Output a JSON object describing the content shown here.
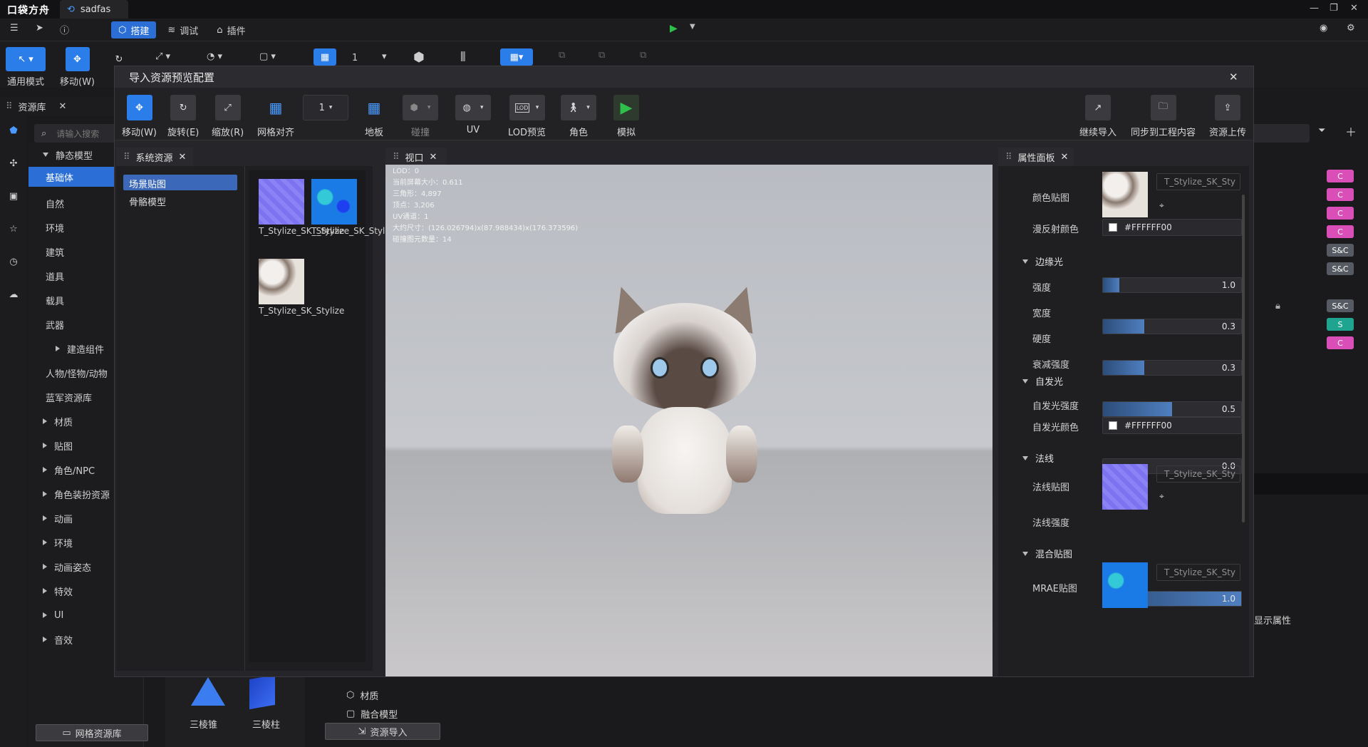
{
  "app": {
    "logo": "口袋方舟",
    "project_tab": "sadfas"
  },
  "menu": {
    "tabs": [
      {
        "label": "搭建"
      },
      {
        "label": "调试"
      },
      {
        "label": "插件"
      }
    ]
  },
  "toolbar": {
    "general_mode": "通用模式",
    "move": "移动(W)",
    "rotate_partial": "旋",
    "num_field": "1"
  },
  "library": {
    "title": "资源库",
    "search_placeholder": "请输入搜索",
    "items": [
      {
        "label": "静态模型"
      },
      {
        "label": "基础体"
      },
      {
        "label": "自然"
      },
      {
        "label": "环境"
      },
      {
        "label": "建筑"
      },
      {
        "label": "道具"
      },
      {
        "label": "载具"
      },
      {
        "label": "武器"
      },
      {
        "label": "建造组件"
      },
      {
        "label": "人物/怪物/动物"
      },
      {
        "label": "蓝军资源库"
      },
      {
        "label": "材质"
      },
      {
        "label": "贴图"
      },
      {
        "label": "角色/NPC"
      },
      {
        "label": "角色装扮资源"
      },
      {
        "label": "动画"
      },
      {
        "label": "环境"
      },
      {
        "label": "动画姿态"
      },
      {
        "label": "特效"
      },
      {
        "label": "UI"
      },
      {
        "label": "音效"
      }
    ],
    "bottom_button": "网格资源库"
  },
  "bottom": {
    "thumbs": [
      {
        "label": "三棱锥"
      },
      {
        "label": "三棱柱"
      }
    ],
    "list": [
      {
        "label": "材质"
      },
      {
        "label": "融合模型"
      }
    ],
    "import_button": "资源导入",
    "show_props": "显示属性"
  },
  "modal": {
    "title": "导入资源预览配置",
    "tools": [
      {
        "label": "移动(W)"
      },
      {
        "label": "旋转(E)"
      },
      {
        "label": "缩放(R)"
      },
      {
        "label": "网格对齐"
      },
      {
        "label": "地板"
      },
      {
        "label": "碰撞"
      },
      {
        "label": "UV"
      },
      {
        "label": "LOD预览"
      },
      {
        "label": "角色"
      },
      {
        "label": "模拟"
      }
    ],
    "grid_value": "1",
    "right_tools": [
      {
        "label": "继续导入"
      },
      {
        "label": "同步到工程内容"
      },
      {
        "label": "资源上传"
      }
    ],
    "system_panel": {
      "title": "系统资源",
      "categories": [
        {
          "label": "场景贴图"
        },
        {
          "label": "骨骼模型"
        }
      ],
      "textures": [
        {
          "label": "T_Stylize_SK_Stylize",
          "kind": "normal"
        },
        {
          "label": "T_Stylize_SK_Stylize",
          "kind": "mrao"
        },
        {
          "label": "T_Stylize_SK_Stylize",
          "kind": "color"
        }
      ]
    },
    "viewport": {
      "title": "视口",
      "stats": [
        "LOD：0",
        "当前屏幕大小：0.611",
        "三角形：4,897",
        "顶点：3,206",
        "UV通道：1",
        "大约尺寸：(126.026794)x(87.988434)x(176.373596)",
        "碰撞图元数量：14"
      ]
    },
    "properties": {
      "title": "属性面板",
      "color_map_label": "颜色贴图",
      "color_map_name": "T_Stylize_SK_Sty",
      "diffuse_label": "漫反射颜色",
      "diffuse_value": "#FFFFFF00",
      "rim_title": "边缘光",
      "rim": [
        {
          "label": "强度",
          "value": "1.0",
          "fill": 0.12
        },
        {
          "label": "宽度",
          "value": "0.3",
          "fill": 0.3
        },
        {
          "label": "硬度",
          "value": "0.3",
          "fill": 0.3
        },
        {
          "label": "衰减强度",
          "value": "0.5",
          "fill": 0.5
        }
      ],
      "emissive_title": "自发光",
      "emissive_strength_label": "自发光强度",
      "emissive_strength_value": "0.0",
      "emissive_color_label": "自发光颜色",
      "emissive_color_value": "#FFFFFF00",
      "normal_title": "法线",
      "normal_map_label": "法线贴图",
      "normal_map_name": "T_Stylize_SK_Sty",
      "normal_strength_label": "法线强度",
      "normal_strength_value": "1.0",
      "mix_title": "混合贴图",
      "mix_map_label": "MRAE贴图",
      "mix_map_name": "T_Stylize_SK_Sty"
    }
  },
  "right_badges": [
    {
      "label": "C",
      "color": "#d94fb7"
    },
    {
      "label": "C",
      "color": "#d94fb7"
    },
    {
      "label": "C",
      "color": "#d94fb7"
    },
    {
      "label": "C",
      "color": "#d94fb7"
    },
    {
      "label": "S&C",
      "color": "#555a63"
    },
    {
      "label": "S&C",
      "color": "#555a63"
    },
    {
      "label": "S&C",
      "color": "#555a63"
    },
    {
      "label": "S",
      "color": "#1fa58f"
    },
    {
      "label": "C",
      "color": "#d94fb7"
    }
  ],
  "colors": {
    "accent": "#2b7de9",
    "play": "#2ec04a"
  }
}
